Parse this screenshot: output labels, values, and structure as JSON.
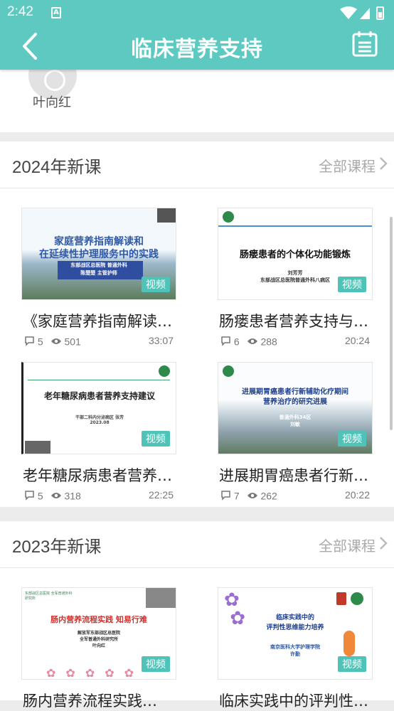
{
  "status_bar": {
    "time": "2:42"
  },
  "app_bar": {
    "title": "临床营养支持"
  },
  "teacher": {
    "name": "叶向红"
  },
  "sections": [
    {
      "title": "2024年新课",
      "more_label": "全部课程",
      "courses": [
        {
          "title": "《家庭营养指南解读…",
          "comments": "5",
          "views": "501",
          "duration": "33:07",
          "badge": "视频",
          "slide": {
            "line1": "家庭营养指南解读和",
            "line2": "在延续性护理服务中的实践",
            "sub1": "东部战区总医院  普通外科",
            "sub2": "陈楚楚  主管护师"
          }
        },
        {
          "title": "肠瘘患者营养支持与…",
          "comments": "6",
          "views": "288",
          "duration": "20:24",
          "badge": "视频",
          "slide": {
            "line1": "肠瘘患者的个体化功能锻炼",
            "sub1": "刘芳芳",
            "sub2": "东部战区总医院普通外科八病区"
          }
        },
        {
          "title": "老年糖尿病患者营养…",
          "comments": "5",
          "views": "318",
          "duration": "22:25",
          "badge": "视频",
          "slide": {
            "line1": "老年糖尿病患者营养支持建议",
            "sub1": "干部二科内分泌病区  张芳",
            "sub2": "2023.08"
          }
        },
        {
          "title": "进展期胃癌患者行新…",
          "comments": "7",
          "views": "262",
          "duration": "20:22",
          "badge": "视频",
          "slide": {
            "line1": "进展期胃癌患者行新辅助化疗期间",
            "line2": "营养治疗的研究进展",
            "sub1": "普通外科34区",
            "sub2": "刘敏"
          }
        }
      ]
    },
    {
      "title": "2023年新课",
      "more_label": "全部课程",
      "courses": [
        {
          "title": "肠内营养流程实践…",
          "badge": "视频",
          "slide": {
            "header": "东部战区总医院 全军普通外科研究所",
            "line1": "肠内营养流程实践   知易行难",
            "sub1": "解放军东部战区总医院",
            "sub2": "全军普通外科研究所",
            "sub3": "叶向红"
          }
        },
        {
          "title": "临床实践中的评判性…",
          "badge": "视频",
          "slide": {
            "line1": "临床实践中的",
            "line2": "评判性思维能力培养",
            "sub1": "南京医科大学护理学院",
            "sub2": "许勤"
          }
        }
      ]
    }
  ],
  "icons": {
    "comment": "comment-icon",
    "views": "eye-icon",
    "back": "back-arrow-icon",
    "calendar": "calendar-icon"
  },
  "colors": {
    "accent": "#5ec9c0",
    "badge": "#4fc3b8"
  }
}
